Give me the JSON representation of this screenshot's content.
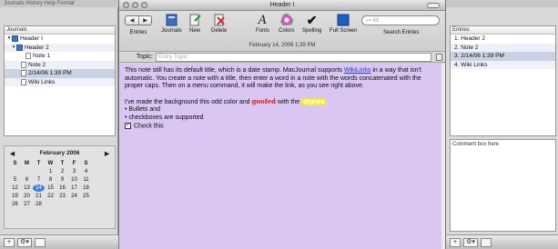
{
  "background_strip": {
    "text": "Journals  History  Help  Format"
  },
  "left": {
    "list_header": "Journals",
    "tree": [
      {
        "label": "Header I",
        "type": "journal",
        "indent": 0,
        "expanded": true
      },
      {
        "label": "Header 2",
        "type": "journal",
        "indent": 1,
        "expanded": true
      },
      {
        "label": "Note 1",
        "type": "note",
        "indent": 3
      },
      {
        "label": "Note 2",
        "type": "note",
        "indent": 2
      },
      {
        "label": "2/14/06 1:39 PM",
        "type": "note",
        "indent": 2,
        "selected": true
      },
      {
        "label": "Wiki Links",
        "type": "note",
        "indent": 2
      }
    ],
    "calendar": {
      "prev": "◀",
      "month": "February 2006",
      "next": "▶",
      "day_headers": [
        "S",
        "M",
        "T",
        "W",
        "T",
        "F",
        "S"
      ],
      "days": [
        "",
        "",
        "",
        "1",
        "2",
        "3",
        "4",
        "5",
        "6",
        "7",
        "8",
        "9",
        "10",
        "11",
        "12",
        "13",
        "14",
        "15",
        "16",
        "17",
        "18",
        "19",
        "20",
        "21",
        "22",
        "23",
        "24",
        "25",
        "26",
        "27",
        "28",
        "",
        "",
        "",
        ""
      ],
      "today": "14"
    }
  },
  "window": {
    "title": "Header I",
    "toolbar": {
      "entries_label": "Entries",
      "journals_label": "Journals",
      "new_label": "New",
      "delete_label": "Delete",
      "fonts_label": "Fonts",
      "colors_label": "Colors",
      "spelling_label": "Spelling",
      "fullscreen_label": "Full Screen",
      "search_label": "Search Entries",
      "search_placeholder": "All",
      "back_glyph": "◀",
      "forward_glyph": "▶"
    },
    "datestamp": "February 14, 2006 1:39 PM",
    "topic_label": "Topic:",
    "topic_placeholder": "Entry Topic",
    "body": {
      "p1_a": "This note still has its default title, which is a date stamp. MacJournal supports ",
      "p1_link": "WikiLinks",
      "p1_b": " in a way that isn't automatic. You create a note with a title, then enter a word in a note with the words concatenated with the proper caps. Then on a menu command, it will make the link, as you see right above.",
      "p2_a": "I've made the background this odd color and ",
      "p2_goofed": "goofed",
      "p2_b": " with the ",
      "p2_styles": "styles",
      "p2_c": ".",
      "bullet1": "• Bullets and",
      "bullet2": "• checkboxes are supported",
      "check_label": "Check this"
    },
    "body_background": "#d9c6f2"
  },
  "right": {
    "list_header": "Entries",
    "entries": [
      "1. Header 2",
      "2. Note 2",
      "3. 2/14/06 1:39 PM",
      "4. Wiki Links"
    ],
    "comment": "Comment box here"
  },
  "bottom_bar": {
    "add": "+",
    "action": "⚙▾"
  }
}
